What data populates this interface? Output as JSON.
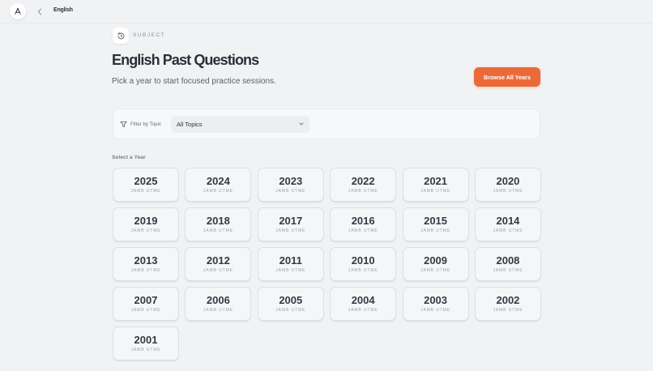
{
  "breadcrumb": {
    "current": "English"
  },
  "subject": {
    "label": "SUBJECT"
  },
  "header": {
    "title": "English Past Questions",
    "subtitle": "Pick a year to start focused practice sessions.",
    "browse_label": "Browse All Years"
  },
  "filter": {
    "label": "Filter by Topic",
    "selected": "All Topics"
  },
  "section": {
    "label": "Select a Year"
  },
  "colors": {
    "accent": "#ea6a3a",
    "background": "#f1f2f3"
  },
  "years": [
    {
      "year": "2025",
      "exam": "JAMB UTME"
    },
    {
      "year": "2024",
      "exam": "JAMB UTME"
    },
    {
      "year": "2023",
      "exam": "JAMB UTME"
    },
    {
      "year": "2022",
      "exam": "JAMB UTME"
    },
    {
      "year": "2021",
      "exam": "JAMB UTME"
    },
    {
      "year": "2020",
      "exam": "JAMB UTME"
    },
    {
      "year": "2019",
      "exam": "JAMB UTME"
    },
    {
      "year": "2018",
      "exam": "JAMB UTME"
    },
    {
      "year": "2017",
      "exam": "JAMB UTME"
    },
    {
      "year": "2016",
      "exam": "JAMB UTME"
    },
    {
      "year": "2015",
      "exam": "JAMB UTME"
    },
    {
      "year": "2014",
      "exam": "JAMB UTME"
    },
    {
      "year": "2013",
      "exam": "JAMB UTME"
    },
    {
      "year": "2012",
      "exam": "JAMB UTME"
    },
    {
      "year": "2011",
      "exam": "JAMB UTME"
    },
    {
      "year": "2010",
      "exam": "JAMB UTME"
    },
    {
      "year": "2009",
      "exam": "JAMB UTME"
    },
    {
      "year": "2008",
      "exam": "JAMB UTME"
    },
    {
      "year": "2007",
      "exam": "JAMB UTME"
    },
    {
      "year": "2006",
      "exam": "JAMB UTME"
    },
    {
      "year": "2005",
      "exam": "JAMB UTME"
    },
    {
      "year": "2004",
      "exam": "JAMB UTME"
    },
    {
      "year": "2003",
      "exam": "JAMB UTME"
    },
    {
      "year": "2002",
      "exam": "JAMB UTME"
    },
    {
      "year": "2001",
      "exam": "JAMB UTME"
    }
  ]
}
